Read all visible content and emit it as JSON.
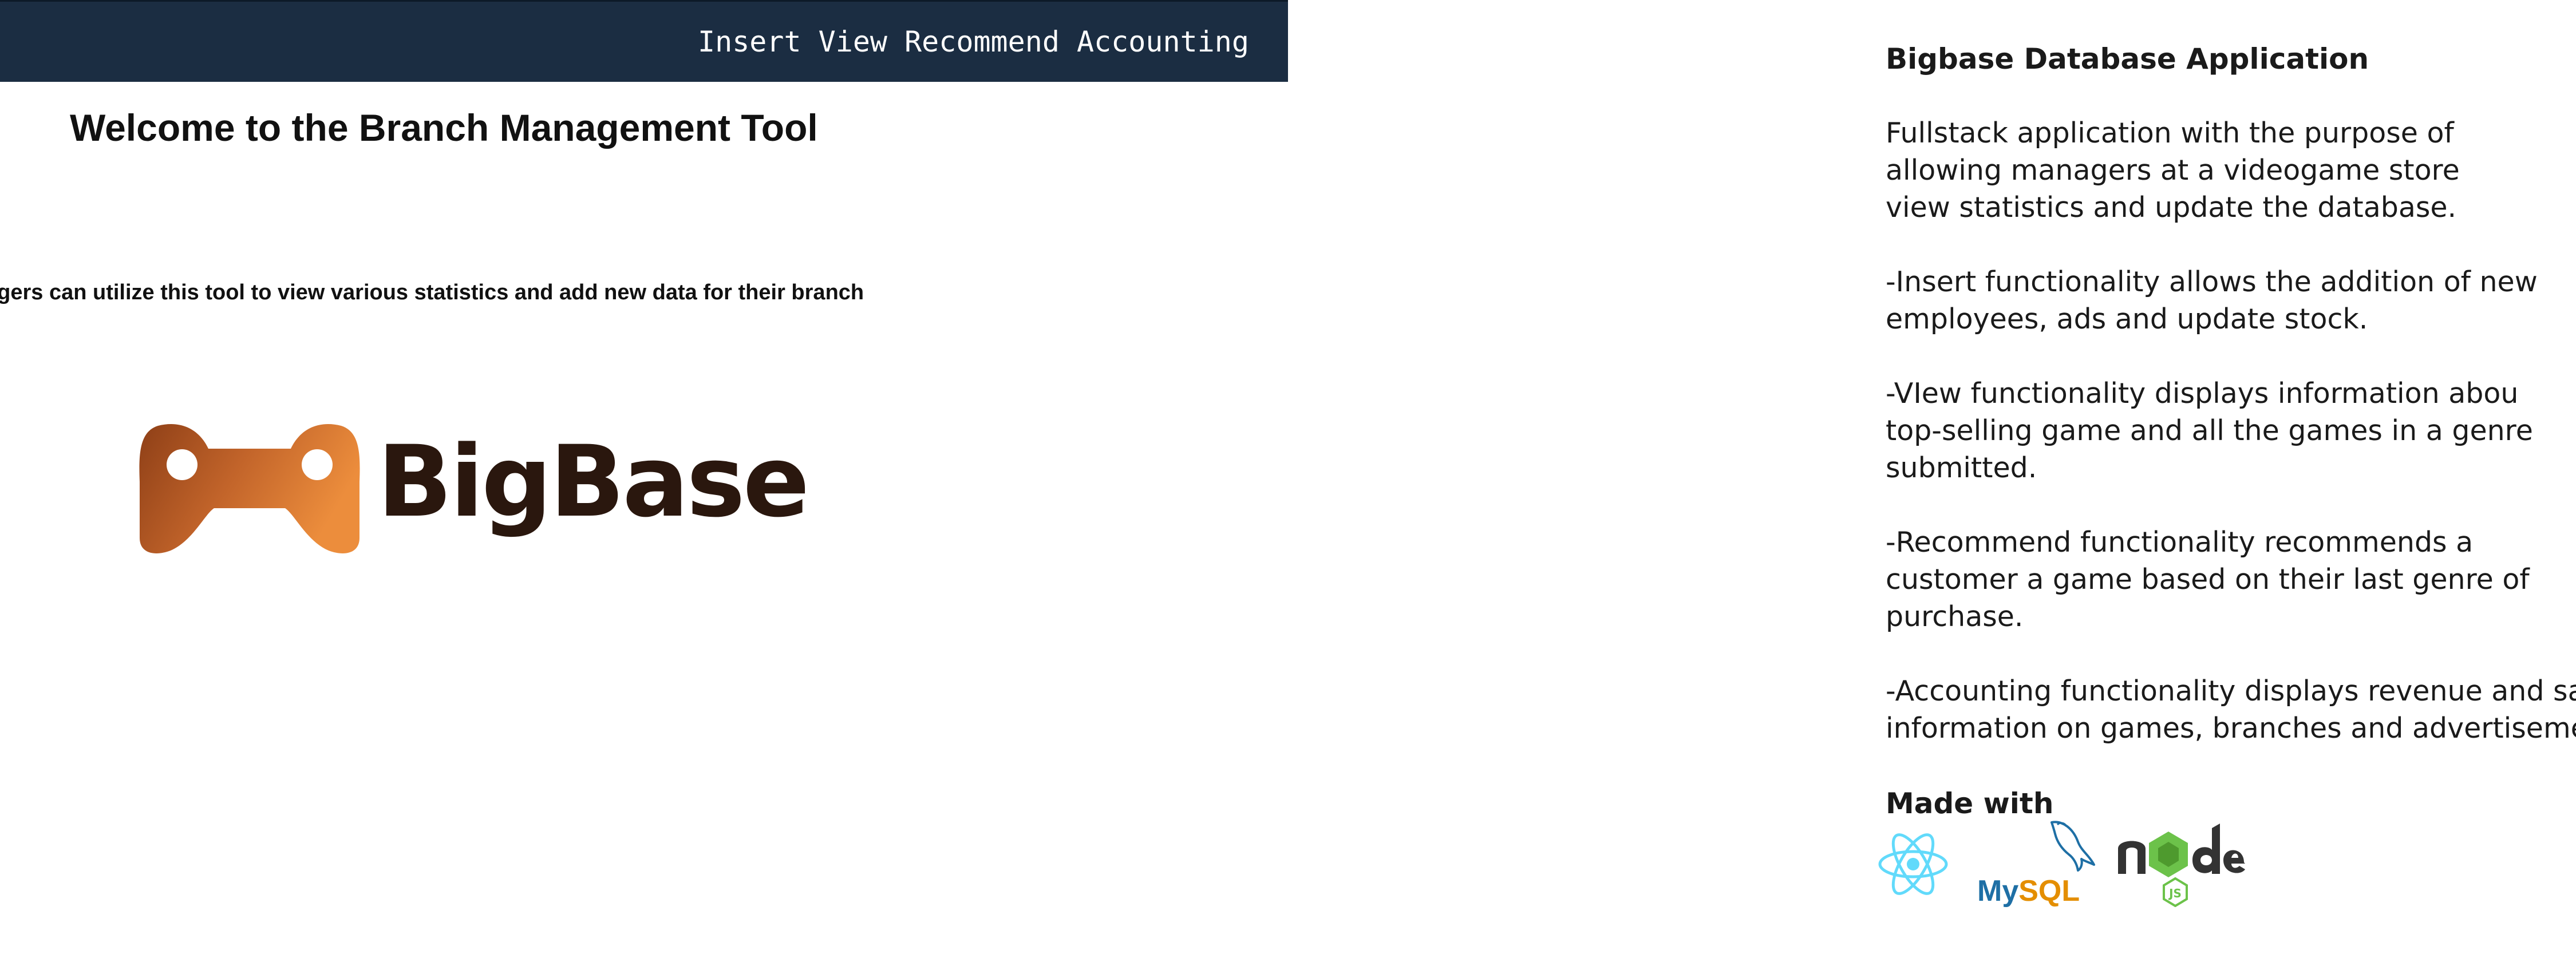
{
  "navbar": {
    "links": [
      "Insert",
      "View",
      "Recommend",
      "Accounting"
    ],
    "background_color": "#1b2d42"
  },
  "main": {
    "title": "Welcome to the Branch Management Tool",
    "subtitle": "Managers can utilize this tool to view various statistics and add new data for their branch",
    "logo": {
      "text": "BigBase",
      "icon": "gamepad-icon",
      "gradient_colors": [
        "#9a4a1c",
        "#e98a3a"
      ],
      "text_color": "#2a170e"
    }
  },
  "readme": {
    "title": "Bigbase Database Application",
    "intro": [
      "Fullstack application with the purpose of",
      "allowing managers at a videogame store",
      "view statistics and update the database."
    ],
    "insert": [
      "-Insert functionality allows the addition of new",
      "employees, ads and update stock."
    ],
    "view": [
      "-VIew functionality displays information abou",
      "top-selling game and all the games in a genre",
      "submitted."
    ],
    "recommend": [
      "-Recommend functionality recommends a",
      "customer a game based on their last genre of",
      "purchase."
    ],
    "accounting": [
      "-Accounting functionality displays revenue and sales",
      "information on games, branches and advertisement."
    ],
    "made_with": "Made with",
    "tech": {
      "react_icon": "react-icon",
      "mysql_my": "My",
      "mysql_sql": "SQL",
      "node_icon": "nodejs-icon",
      "react_color": "#61dafb",
      "mysql_blue": "#1e6fa5",
      "mysql_orange": "#e48e00",
      "node_green": "#6cc24a",
      "node_dark": "#333333"
    }
  }
}
